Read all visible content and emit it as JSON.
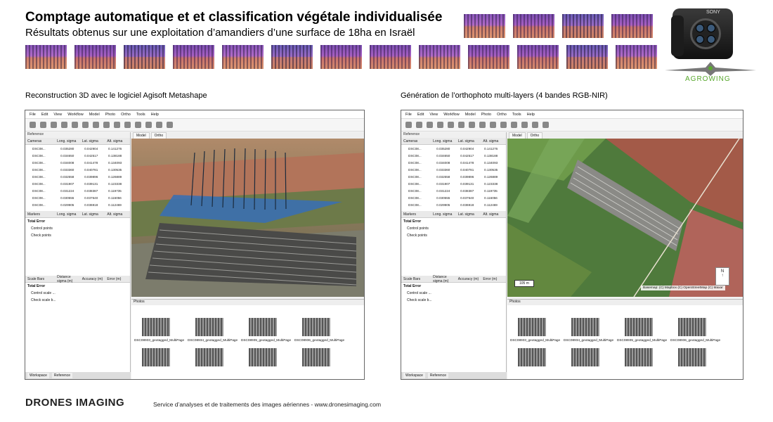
{
  "header": {
    "title": "Comptage automatique et et classification végétale individualisée",
    "subtitle": "Résultats obtenus sur une exploitation d’amandiers d’une surface de 18ha en Israël"
  },
  "logos": {
    "camera_brand": "SONY",
    "agrowing": "AGROWING"
  },
  "sections": {
    "left_label": "Reconstruction 3D avec le logiciel Agisoft Metashape",
    "right_label": "Génération de l’orthophoto multi-layers (4 bandes RGB-NIR)"
  },
  "app": {
    "menu": [
      "File",
      "Edit",
      "View",
      "Workflow",
      "Model",
      "Photo",
      "Ortho",
      "Tools",
      "Help"
    ],
    "reference_title": "Reference",
    "columns": [
      "Cameras",
      "Long. sigma",
      "Lat. sigma",
      "Alt. sigma"
    ],
    "cameras": [
      [
        "DSC08...",
        "0.035280",
        "0.042904",
        "0.141276"
      ],
      [
        "DSC08...",
        "0.034650",
        "0.042517",
        "0.138188"
      ],
      [
        "DSC08...",
        "0.034008",
        "0.041478",
        "0.134093"
      ],
      [
        "DSC08...",
        "0.033360",
        "0.040781",
        "0.130535"
      ],
      [
        "DSC08...",
        "0.032558",
        "0.039896",
        "0.126889"
      ],
      [
        "DSC08...",
        "0.031907",
        "0.039131",
        "0.123338"
      ],
      [
        "DSC08...",
        "0.031224",
        "0.038387",
        "0.119735"
      ],
      [
        "DSC08...",
        "0.030555",
        "0.037640",
        "0.116056"
      ],
      [
        "DSC08...",
        "0.029905",
        "0.036918",
        "0.112469"
      ]
    ],
    "markers_columns": [
      "Markers",
      "Long. sigma",
      "Lat. sigma",
      "Alt. sigma"
    ],
    "total_error": "Total Error",
    "control_points": "Control points",
    "check_points": "Check points",
    "scalebars_columns": [
      "Scale Bars",
      "Distance sigma (m)",
      "Accuracy (m)",
      "Error (m)"
    ],
    "control_scale": "Control scale ...",
    "check_scale": "Check scale b...",
    "bottom_tabs": [
      "Workspace",
      "Reference"
    ],
    "view_tabs": [
      "Model",
      "Ortho"
    ],
    "perspective": "Perspective 30°",
    "photos_title": "Photos",
    "photo_labels": [
      "DSC08933_geotagged_MultiPage",
      "DSC08934_geotagged_MultiPage",
      "DSC08935_geotagged_MultiPage",
      "DSC08936_geotagged_MultiPage"
    ],
    "scale_bar": "105 m",
    "map_attribution": "Basemap: (C) Mapbox (C) OpenStreetMap (C) Maxar",
    "north": "N"
  },
  "footer": {
    "logo": "DRONES IMAGING",
    "text": "Service d’analyses et de traitements des images aériennes - www.dronesimaging.com"
  }
}
